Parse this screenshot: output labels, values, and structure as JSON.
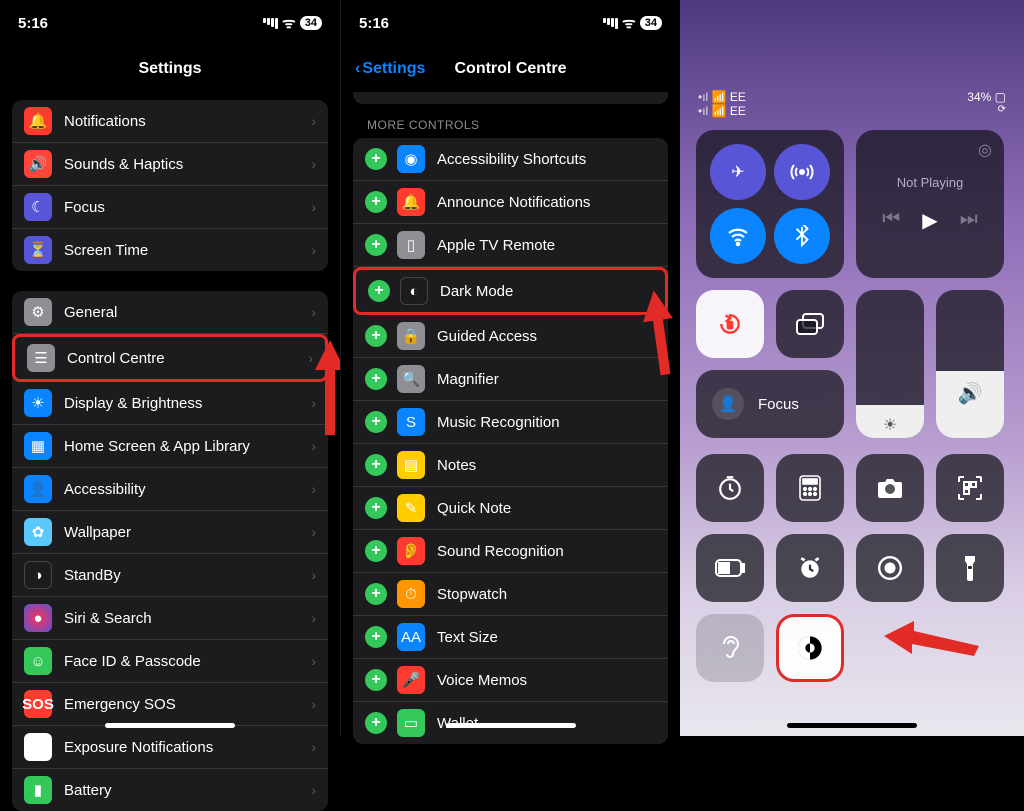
{
  "left": {
    "time": "5:16",
    "battery_label": "34",
    "page_title": "Settings",
    "group1": [
      {
        "icon": "bell",
        "bg": "ib-red",
        "label": "Notifications"
      },
      {
        "icon": "speaker",
        "bg": "ib-red2",
        "label": "Sounds & Haptics"
      },
      {
        "icon": "moon",
        "bg": "ib-purple",
        "label": "Focus"
      },
      {
        "icon": "hourglass",
        "bg": "ib-purple",
        "label": "Screen Time"
      }
    ],
    "group2": [
      {
        "icon": "gear",
        "bg": "ib-grey",
        "label": "General"
      },
      {
        "icon": "switches",
        "bg": "ib-grey",
        "label": "Control Centre",
        "highlight": true
      },
      {
        "icon": "sun",
        "bg": "ib-blue",
        "label": "Display & Brightness"
      },
      {
        "icon": "grid",
        "bg": "ib-blue",
        "label": "Home Screen & App Library"
      },
      {
        "icon": "person",
        "bg": "ib-blue",
        "label": "Accessibility"
      },
      {
        "icon": "flower",
        "bg": "ib-teal",
        "label": "Wallpaper"
      },
      {
        "icon": "standby",
        "bg": "ib-dark",
        "label": "StandBy"
      },
      {
        "icon": "siri",
        "bg": "ib-siri",
        "label": "Siri & Search"
      },
      {
        "icon": "faceid",
        "bg": "ib-green",
        "label": "Face ID & Passcode"
      },
      {
        "icon": "sos",
        "bg": "ib-sos",
        "label": "Emergency SOS"
      },
      {
        "icon": "virus",
        "bg": "ib-white",
        "label": "Exposure Notifications"
      },
      {
        "icon": "battery",
        "bg": "ib-green",
        "label": "Battery"
      }
    ]
  },
  "mid": {
    "time": "5:16",
    "battery_label": "34",
    "back_label": "Settings",
    "page_title": "Control Centre",
    "section_header": "MORE CONTROLS",
    "controls": [
      {
        "icon": "access",
        "bg": "ib-blue",
        "label": "Accessibility Shortcuts"
      },
      {
        "icon": "bell",
        "bg": "ib-red",
        "label": "Announce Notifications"
      },
      {
        "icon": "remote",
        "bg": "ib-grey",
        "label": "Apple TV Remote"
      },
      {
        "icon": "darkmode",
        "bg": "ib-dark",
        "label": "Dark Mode",
        "highlight": true
      },
      {
        "icon": "lock",
        "bg": "ib-grey",
        "label": "Guided Access"
      },
      {
        "icon": "magnifier",
        "bg": "ib-grey",
        "label": "Magnifier"
      },
      {
        "icon": "shazam",
        "bg": "ib-blue",
        "label": "Music Recognition"
      },
      {
        "icon": "notes",
        "bg": "ib-yellow",
        "label": "Notes"
      },
      {
        "icon": "quicknote",
        "bg": "ib-yellow",
        "label": "Quick Note"
      },
      {
        "icon": "ear",
        "bg": "ib-red",
        "label": "Sound Recognition"
      },
      {
        "icon": "stopwatch",
        "bg": "ib-orange",
        "label": "Stopwatch"
      },
      {
        "icon": "textsize",
        "bg": "ib-blue",
        "label": "Text Size"
      },
      {
        "icon": "mic",
        "bg": "ib-red",
        "label": "Voice Memos"
      },
      {
        "icon": "wallet",
        "bg": "ib-green",
        "label": "Wallet"
      }
    ]
  },
  "right": {
    "carrier_line1": "EE",
    "carrier_line2": "EE",
    "battery_pct": "34%",
    "media_label": "Not Playing",
    "focus_label": "Focus",
    "brightness_pct": 22,
    "volume_pct": 45
  },
  "icons": {
    "bell": "🔔",
    "speaker": "🔊",
    "moon": "☾",
    "hourglass": "⏳",
    "gear": "⚙",
    "switches": "☰",
    "sun": "☀",
    "grid": "▦",
    "person": "👤",
    "flower": "✿",
    "standby": "◑",
    "siri": "●",
    "faceid": "☺",
    "sos": "SOS",
    "virus": "✱",
    "battery": "▮",
    "access": "◉",
    "remote": "▯",
    "darkmode": "◐",
    "lock": "🔒",
    "magnifier": "🔍",
    "shazam": "S",
    "notes": "▤",
    "quicknote": "✎",
    "ear": "👂",
    "stopwatch": "⏱",
    "textsize": "AA",
    "mic": "🎤",
    "wallet": "▭"
  }
}
